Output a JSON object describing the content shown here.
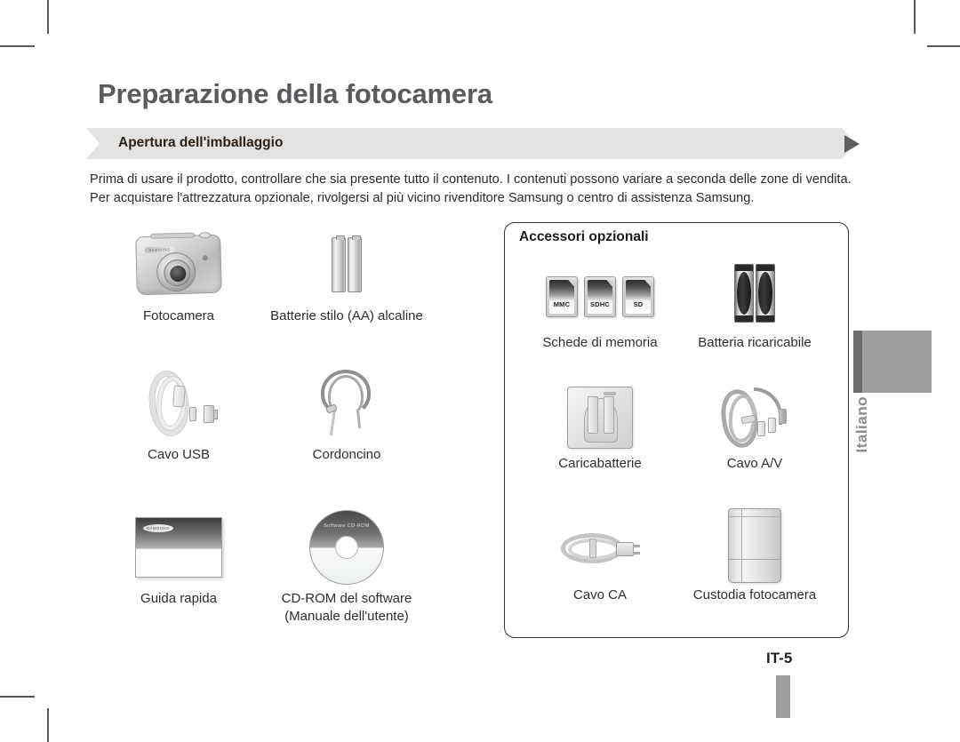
{
  "page": {
    "title": "Preparazione della fotocamera",
    "section_header": "Apertura dell'imballaggio",
    "section_arrow_icon": "play-triangle-icon",
    "intro": "Prima di usare il prodotto, controllare che sia presente tutto il contenuto. I contenuti possono variare a seconda delle zone di vendita. Per acquistare l'attrezzatura opzionale, rivolgersi al più vicino rivenditore Samsung o centro di assistenza Samsung.",
    "page_number": "IT-5",
    "language_tab": "Italiano"
  },
  "included_items": [
    {
      "caption": "Fotocamera",
      "icon": "camera-icon"
    },
    {
      "caption": "Batterie stilo (AA) alcaline",
      "icon": "aa-batteries-icon"
    },
    {
      "caption": "Cavo USB",
      "icon": "usb-cable-icon"
    },
    {
      "caption": "Cordoncino",
      "icon": "wrist-strap-icon"
    },
    {
      "caption": "Guida rapida",
      "icon": "quick-guide-booklet-icon"
    },
    {
      "caption": "CD-ROM del software",
      "caption2": "(Manuale dell'utente)",
      "icon": "software-cd-icon",
      "cd_label": "Software CD-ROM"
    }
  ],
  "optional_accessories": {
    "title": "Accessori opzionali",
    "items": [
      {
        "caption": "Schede di memoria",
        "icon": "memory-cards-icon",
        "cards": [
          "MMC",
          "SDHC",
          "SD"
        ]
      },
      {
        "caption": "Batteria ricaricabile",
        "icon": "rechargeable-battery-icon"
      },
      {
        "caption": "Caricabatterie",
        "icon": "battery-charger-icon"
      },
      {
        "caption": "Cavo A/V",
        "icon": "av-cable-icon"
      },
      {
        "caption": "Cavo CA",
        "icon": "ac-power-cable-icon"
      },
      {
        "caption": "Custodia fotocamera",
        "icon": "camera-case-icon"
      }
    ]
  },
  "brand": {
    "name": "SAMSUNG"
  },
  "colors": {
    "title_gray": "#5b5a5e",
    "header_bar": "#e3e3e3",
    "tab_gray": "#9e9e9e",
    "tab_edge": "#6b6b6b",
    "panel_border": "#3c3233",
    "text": "#231f20"
  }
}
